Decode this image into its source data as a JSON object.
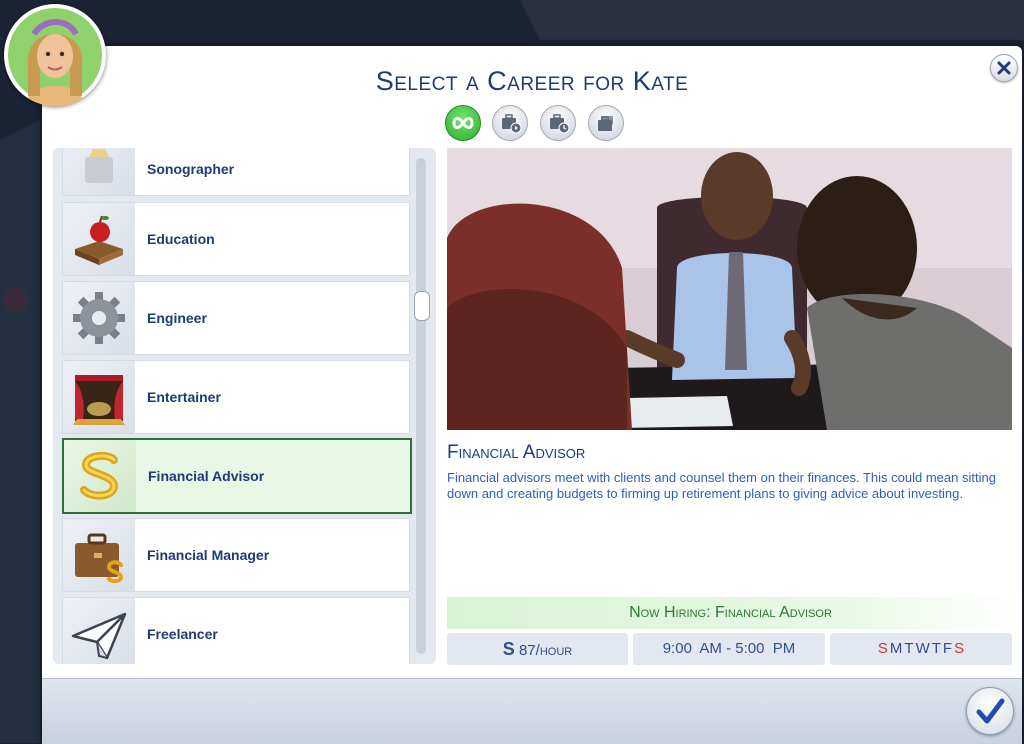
{
  "dialog": {
    "title": "Select a Career for Kate"
  },
  "filters": [
    {
      "name": "all-careers",
      "icon": "infinity-icon",
      "active": true
    },
    {
      "name": "part-time-careers",
      "icon": "briefcase-play-icon",
      "active": false
    },
    {
      "name": "full-time-careers",
      "icon": "briefcase-clock-icon",
      "active": false
    },
    {
      "name": "freelance-careers",
      "icon": "briefcase-stack-icon",
      "active": false
    }
  ],
  "careers": [
    {
      "label": "Sonographer",
      "icon": "sonographer-icon"
    },
    {
      "label": "Education",
      "icon": "apple-on-book-icon"
    },
    {
      "label": "Engineer",
      "icon": "gear-icon"
    },
    {
      "label": "Entertainer",
      "icon": "stage-curtain-icon"
    },
    {
      "label": "Financial Advisor",
      "icon": "simoleon-icon",
      "selected": true
    },
    {
      "label": "Financial Manager",
      "icon": "briefcase-simoleon-icon"
    },
    {
      "label": "Freelancer",
      "icon": "paper-plane-icon"
    }
  ],
  "detail": {
    "title": "Financial Advisor",
    "description": "Financial advisors meet with clients and counsel them on their finances. This could mean sitting down and creating budgets to firming up retirement plans to giving advice about investing.",
    "hiring": "Now Hiring: Financial Advisor",
    "pay_symbol": "S",
    "pay": "87/hour",
    "hours": "9:00  AM - 5:00  PM",
    "days": [
      "S",
      "M",
      "T",
      "W",
      "T",
      "F",
      "S"
    ],
    "weekend_color": "#d2322f"
  },
  "colors": {
    "title": "#1e3b78",
    "accent_green": "#2e6f3c",
    "link_blue": "#2d5fc0"
  }
}
